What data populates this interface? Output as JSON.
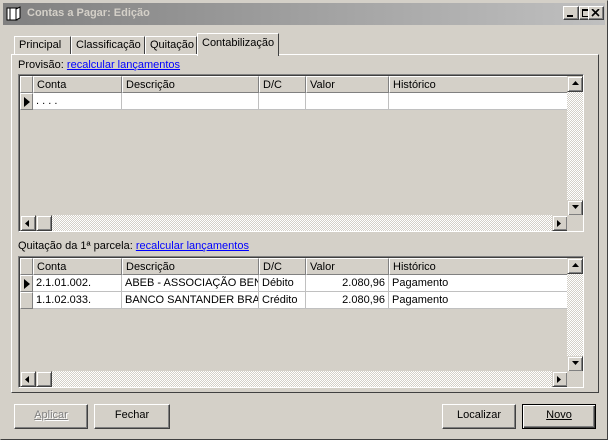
{
  "window": {
    "title": "Contas a Pagar: Edição",
    "controls": [
      "minimize",
      "maximize",
      "close"
    ]
  },
  "tabs": [
    {
      "label": "Principal",
      "active": false
    },
    {
      "label": "Classificação",
      "active": false
    },
    {
      "label": "Quitação",
      "active": false
    },
    {
      "label": "Contabilização",
      "active": true
    }
  ],
  "provisao": {
    "label": "Provisão:",
    "link": "recalcular lançamentos",
    "columns": [
      "Conta",
      "Descrição",
      "D/C",
      "Valor",
      "Histórico"
    ],
    "rows": [
      {
        "conta": " .  .  .  .",
        "descricao": "",
        "dc": "",
        "valor": "",
        "historico": "",
        "current": true
      }
    ]
  },
  "quitacao": {
    "label": "Quitação da 1ª parcela:",
    "link": "recalcular lançamentos",
    "columns": [
      "Conta",
      "Descrição",
      "D/C",
      "Valor",
      "Histórico"
    ],
    "rows": [
      {
        "conta": "2.1.01.002.",
        "descricao": "ABEB - ASSOCIAÇÃO BENE",
        "dc": "Débito",
        "valor": "2.080,96",
        "historico": "Pagamento",
        "current": true
      },
      {
        "conta": "1.1.02.033.",
        "descricao": "BANCO SANTANDER BRAS",
        "dc": "Crédito",
        "valor": "2.080,96",
        "historico": "Pagamento",
        "current": false
      }
    ]
  },
  "buttons": {
    "aplicar": "Aplicar",
    "fechar": "Fechar",
    "localizar": "Localizar",
    "novo": "Novo"
  },
  "colors": {
    "face": "#d4d0c8",
    "link": "#0000ff",
    "title_inactive": "#808080"
  }
}
